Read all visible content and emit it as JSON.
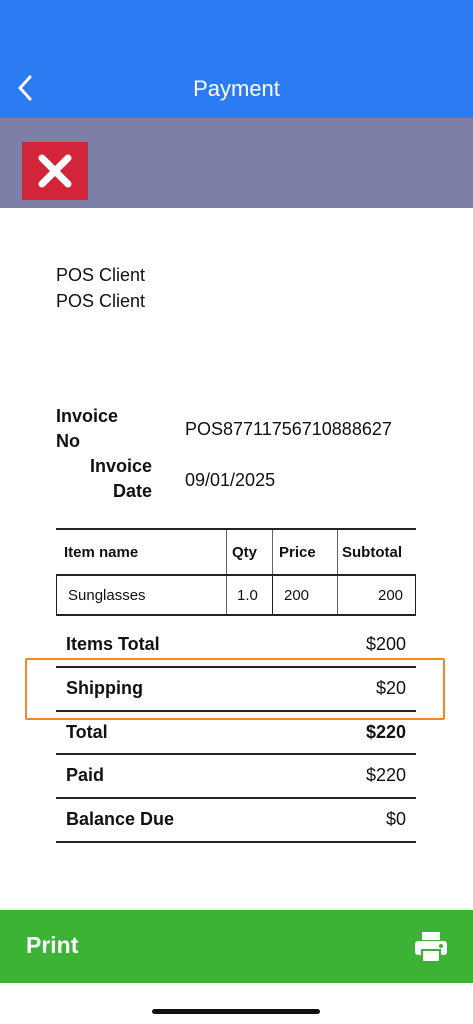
{
  "nav": {
    "title": "Payment",
    "back_icon": "chevron-left-icon"
  },
  "toolbar": {
    "close_icon": "close-icon",
    "close_color": "#d3253a"
  },
  "client": {
    "line1": "POS Client",
    "line2": "POS Client"
  },
  "invoice": {
    "no_label_line1": "Invoice",
    "no_label_line2": "No",
    "no_value": "POS8771175671088862​7",
    "date_label_line1": "Invoice",
    "date_label_line2": "Date",
    "date_value": "09/01/2025"
  },
  "table": {
    "headers": [
      "Item name",
      "Qty",
      "Price",
      "Subtotal"
    ],
    "rows": [
      {
        "name": "Sunglasses",
        "qty": "1.0",
        "price": "200",
        "subtotal": "200"
      }
    ]
  },
  "summary": [
    {
      "label": "Items Total",
      "value": "$200",
      "bold_value": false
    },
    {
      "label": "Shipping",
      "value": "$20",
      "bold_value": false
    },
    {
      "label": "Total",
      "value": "$220",
      "bold_value": true
    },
    {
      "label": "Paid",
      "value": "$220",
      "bold_value": false
    },
    {
      "label": "Balance Due",
      "value": "$0",
      "bold_value": false
    }
  ],
  "print": {
    "label": "Print",
    "icon": "printer-icon"
  },
  "colors": {
    "header": "#2b7cf3",
    "toolbar": "#7c7fa6",
    "print": "#3db336",
    "highlight": "#f08a28"
  }
}
